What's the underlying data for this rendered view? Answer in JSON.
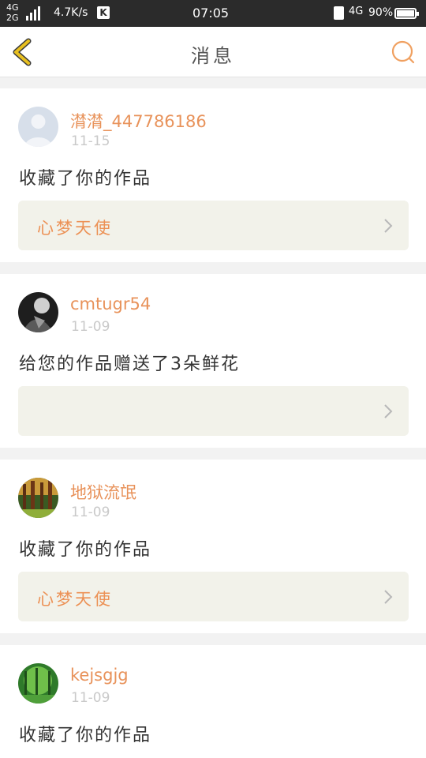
{
  "status_bar": {
    "network": "4G\n2G",
    "speed": "4.7K/s",
    "k_badge": "K",
    "time": "07:05",
    "net_type": "4G",
    "battery": "90%"
  },
  "header": {
    "title": "消息",
    "back_icon": "chevron-left-icon",
    "search_icon": "search-icon"
  },
  "colors": {
    "accent": "#e8925a",
    "back_icon": "#e8c020",
    "card_link_bg": "#f2f2ea"
  },
  "notifications": [
    {
      "username": "潸潸_447786186",
      "date": "11-15",
      "message": "收藏了你的作品",
      "work_title": "心梦天使",
      "avatar": "default-avatar"
    },
    {
      "username": "cmtugr54",
      "date": "11-09",
      "message": "给您的作品赠送了3朵鲜花",
      "work_title": "",
      "avatar": "photo-avatar"
    },
    {
      "username": "地狱流氓",
      "date": "11-09",
      "message": "收藏了你的作品",
      "work_title": "心梦天使",
      "avatar": "forest-avatar"
    },
    {
      "username": "kejsgjg",
      "date": "11-09",
      "message": "收藏了你的作品",
      "work_title": "",
      "avatar": "green-avatar"
    }
  ]
}
